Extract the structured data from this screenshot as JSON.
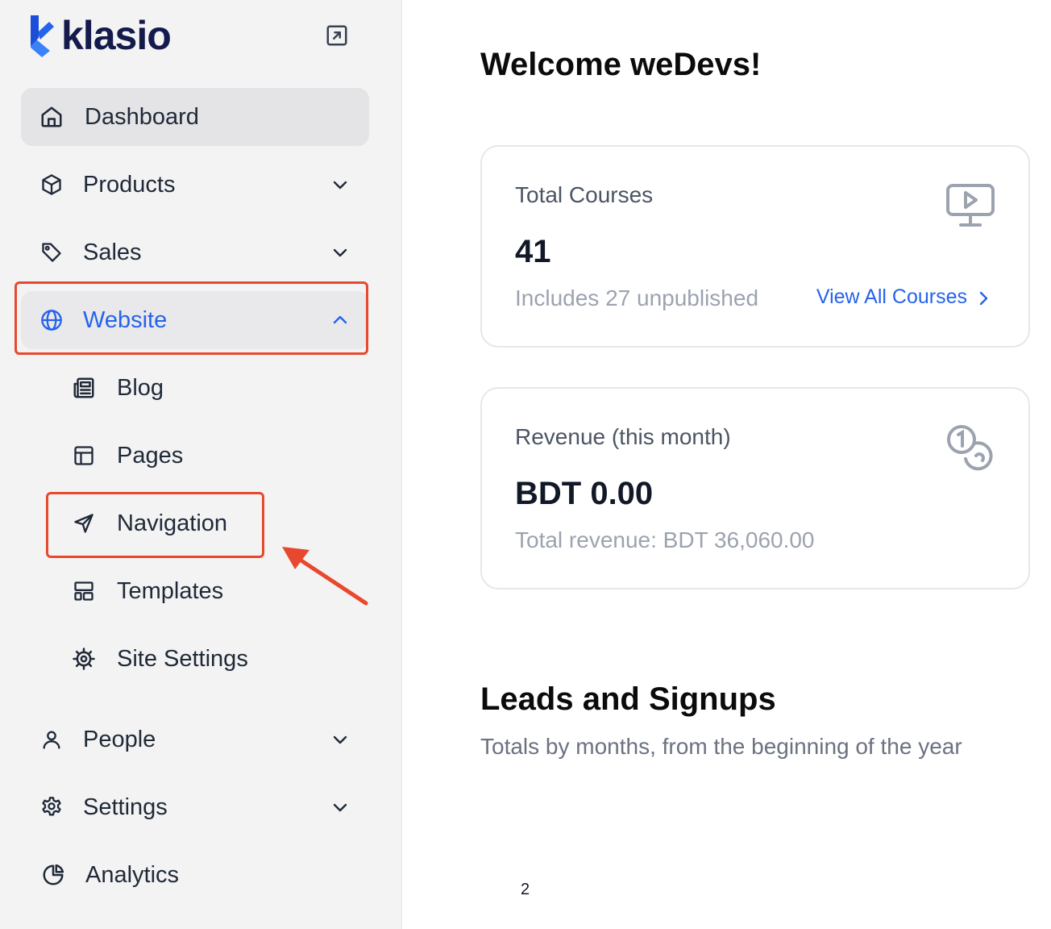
{
  "brand": {
    "name": "klasio",
    "accent": "#2563eb",
    "highlight": "#e8492e"
  },
  "sidebar": {
    "items": [
      {
        "label": "Dashboard",
        "icon": "home-icon"
      },
      {
        "label": "Products",
        "icon": "cube-icon"
      },
      {
        "label": "Sales",
        "icon": "tag-icon"
      },
      {
        "label": "Website",
        "icon": "globe-icon"
      },
      {
        "label": "People",
        "icon": "user-icon"
      },
      {
        "label": "Settings",
        "icon": "gear-icon"
      },
      {
        "label": "Analytics",
        "icon": "pie-chart-icon"
      }
    ],
    "website_sub": [
      {
        "label": "Blog",
        "icon": "newspaper-icon"
      },
      {
        "label": "Pages",
        "icon": "layout-icon"
      },
      {
        "label": "Navigation",
        "icon": "send-icon"
      },
      {
        "label": "Templates",
        "icon": "template-icon"
      },
      {
        "label": "Site Settings",
        "icon": "cog-icon"
      }
    ]
  },
  "main": {
    "welcome": "Welcome weDevs!",
    "cards": [
      {
        "title": "Total Courses",
        "value": "41",
        "sub": "Includes 27 unpublished",
        "link": "View All Courses",
        "icon": "monitor-play-icon"
      },
      {
        "title": "Revenue (this month)",
        "value": "BDT 0.00",
        "sub": "Total revenue: BDT 36,060.00",
        "icon": "coins-icon"
      }
    ],
    "section_title": "Leads and Signups",
    "section_sub": "Totals by months, from the beginning of the year",
    "page_number": "2"
  }
}
